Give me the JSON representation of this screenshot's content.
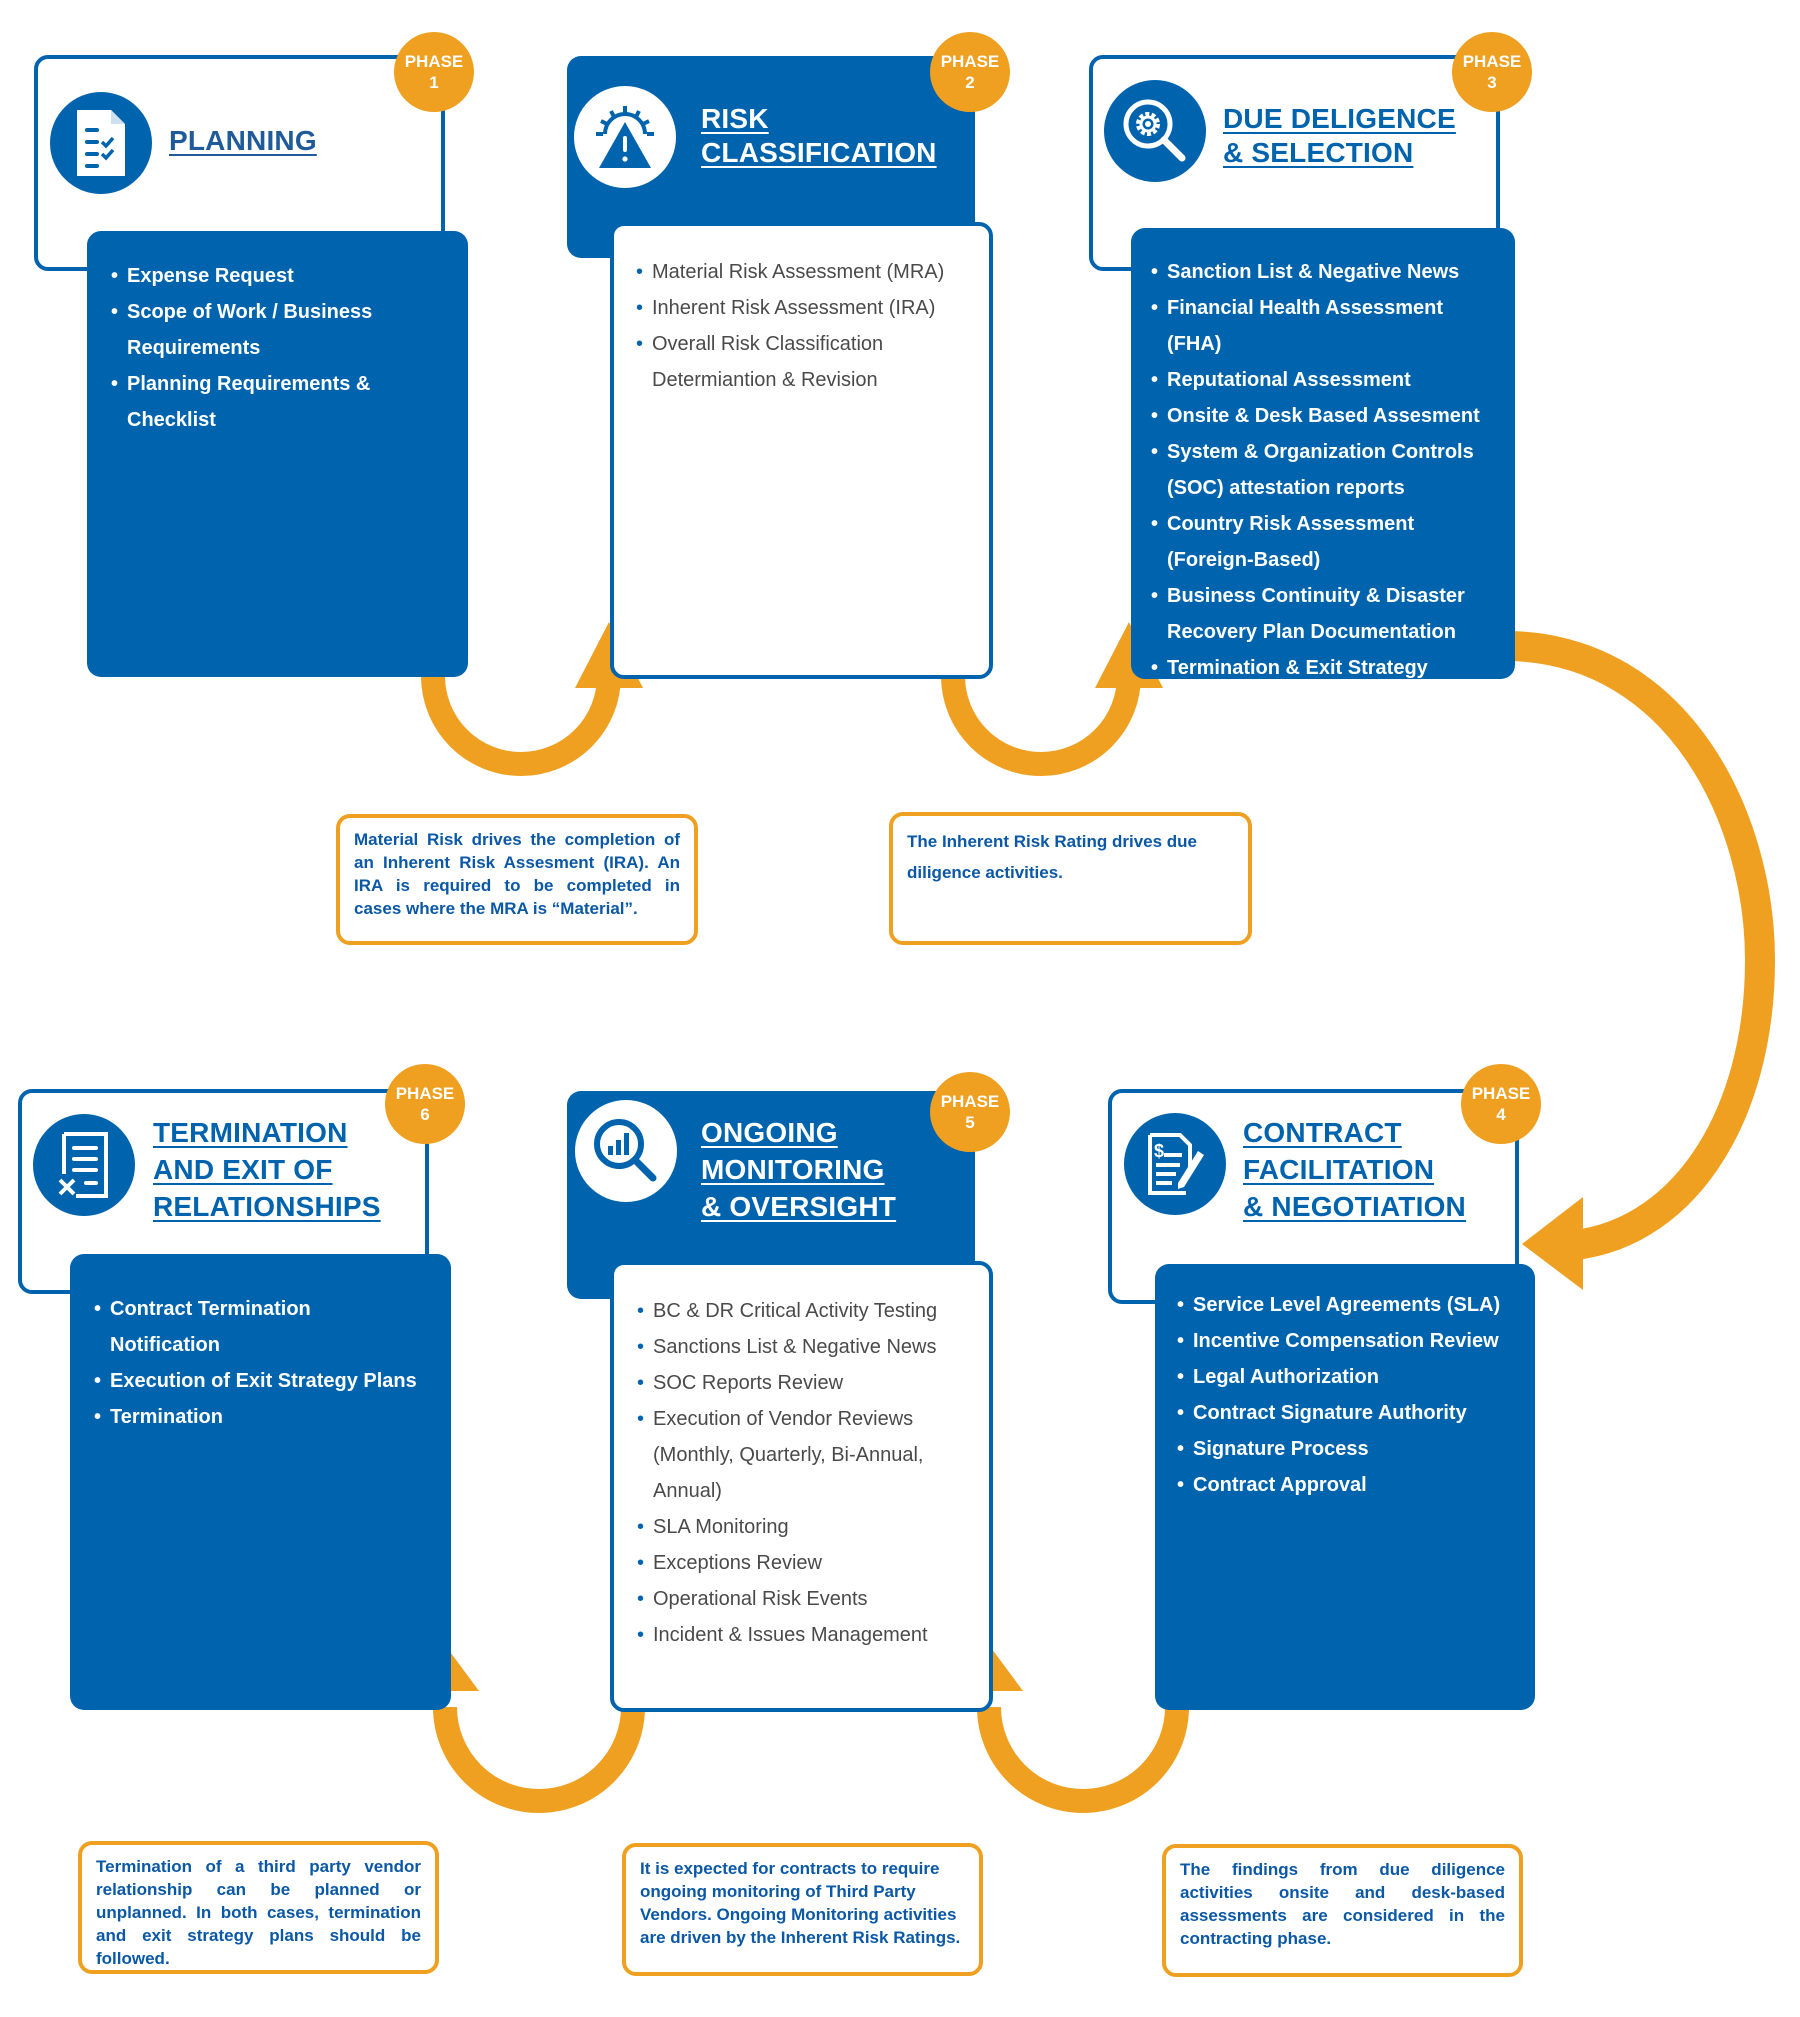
{
  "colors": {
    "brand_blue": "#0063ad",
    "accent_orange": "#efa020",
    "note_text": "#0a58a6",
    "body_text_gray": "#4a4a4a"
  },
  "phases": [
    {
      "badge_label": "PHASE",
      "badge_number": "1",
      "icon": "checklist-document-icon",
      "title_lines": [
        "PLANNING"
      ],
      "items": [
        "Expense Request",
        "Scope of Work / Business Requirements",
        "Planning Requirements & Checklist"
      ]
    },
    {
      "badge_label": "PHASE",
      "badge_number": "2",
      "icon": "warning-gear-icon",
      "title_lines": [
        "RISK",
        "CLASSIFICATION"
      ],
      "items": [
        "Material Risk Assessment (MRA)",
        "Inherent Risk Assessment (IRA)",
        "Overall Risk Classification Determiantion & Revision"
      ]
    },
    {
      "badge_label": "PHASE",
      "badge_number": "3",
      "icon": "magnifier-gear-icon",
      "title_lines": [
        "DUE DELIGENCE",
        "& SELECTION"
      ],
      "items": [
        "Sanction List & Negative News",
        "Financial Health Assessment (FHA)",
        "Reputational Assessment",
        "Onsite & Desk Based Assesment",
        "System & Organization Controls (SOC) attestation reports",
        "Country Risk Assessment (Foreign-Based)",
        "Business Continuity & Disaster Recovery Plan Documentation",
        "Termination & Exit Strategy"
      ]
    },
    {
      "badge_label": "PHASE",
      "badge_number": "4",
      "icon": "contract-pen-icon",
      "title_lines": [
        "CONTRACT",
        "FACILITATION",
        "& NEGOTIATION"
      ],
      "items": [
        "Service Level Agreements (SLA)",
        "Incentive Compensation Review",
        "Legal Authorization",
        "Contract Signature Authority",
        "Signature Process",
        "Contract Approval"
      ]
    },
    {
      "badge_label": "PHASE",
      "badge_number": "5",
      "icon": "magnifier-chart-icon",
      "title_lines": [
        "ONGOING",
        "MONITORING",
        "& OVERSIGHT"
      ],
      "items": [
        "BC & DR Critical Activity Testing",
        "Sanctions List & Negative News",
        "SOC Reports Review",
        "Execution of Vendor Reviews (Monthly, Quarterly, Bi-Annual, Annual)",
        "SLA Monitoring",
        "Exceptions Review",
        "Operational Risk Events",
        "Incident & Issues Management"
      ]
    },
    {
      "badge_label": "PHASE",
      "badge_number": "6",
      "icon": "document-x-icon",
      "title_lines": [
        "TERMINATION",
        "AND EXIT OF",
        "RELATIONSHIPS"
      ],
      "items": [
        "Contract Termination Notification",
        "Execution of Exit Strategy Plans",
        "Termination"
      ]
    }
  ],
  "notes": {
    "mra_to_ira": "Material Risk drives the completion of an Inherent Risk Assesment (IRA). An IRA is required to be completed in cases where the MRA is “Material”.",
    "ira_to_due_diligence": "The Inherent Risk Rating drives due diligence activities.",
    "termination": "Termination of a third party vendor relationship can be planned or unplanned. In both cases, termination and exit strategy plans should be followed.",
    "ongoing_monitoring": "It is expected for contracts to require ongoing monitoring of Third Party Vendors. Ongoing Monitoring activities are driven by the Inherent Risk Ratings.",
    "contracting": "The findings from due diligence activities onsite and desk-based assessments are considered in the contracting phase."
  }
}
